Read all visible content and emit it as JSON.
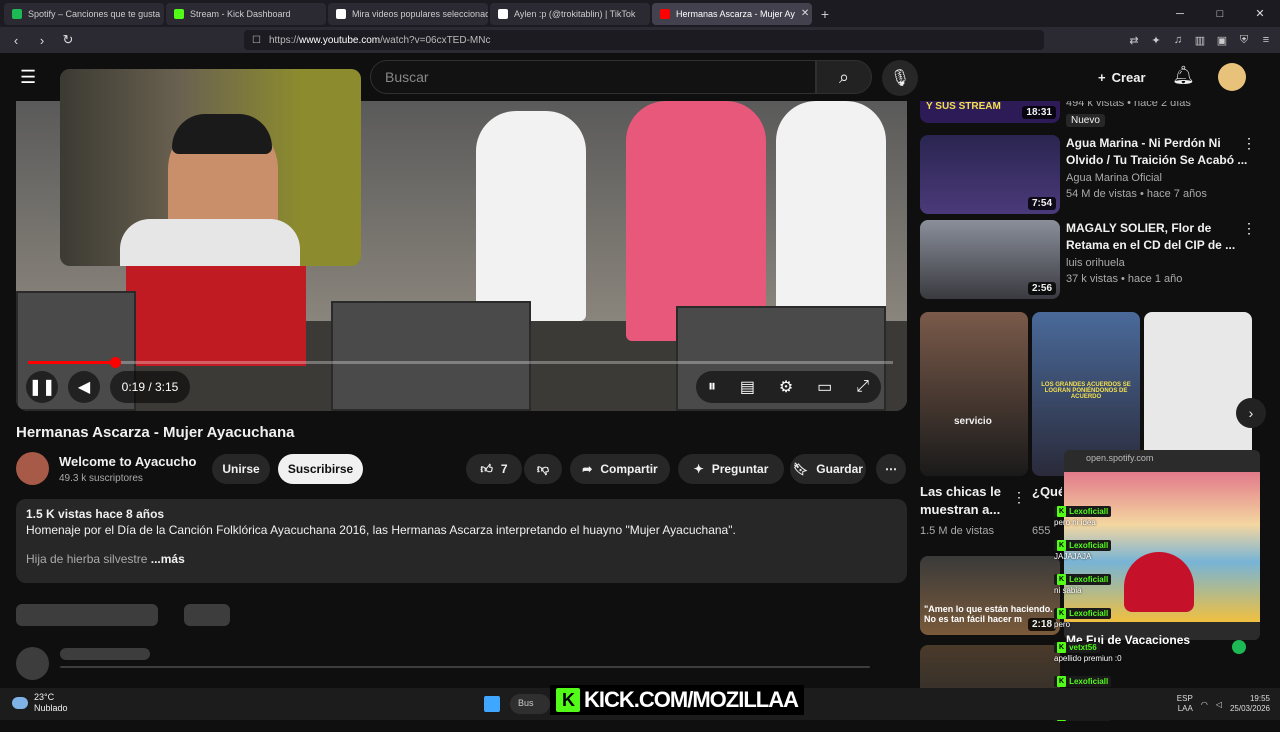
{
  "browser": {
    "tabs": [
      {
        "label": "Spotify – Canciones que te gusta",
        "color": "#1db954",
        "active": false
      },
      {
        "label": "Stream - Kick Dashboard",
        "color": "#53fc18",
        "active": false
      },
      {
        "label": "Mira videos populares seleccionado",
        "color": "#ffffff",
        "active": false
      },
      {
        "label": "Aylen :p (@trokitablin) | TikTok",
        "color": "#ffffff",
        "active": false
      },
      {
        "label": "Hermanas Ascarza - Mujer Ay",
        "color": "#ff0000",
        "active": true
      }
    ],
    "url_prefix": "https://",
    "url_domain": "www.youtube.com",
    "url_path": "/watch?v=06cxTED-MNc"
  },
  "header": {
    "search_placeholder": "Buscar",
    "create_label": "Crear"
  },
  "player": {
    "progress_fraction": 0.1,
    "time_label": "0:19 / 3:15"
  },
  "video": {
    "title": "Hermanas Ascarza - Mujer Ayacuchana",
    "channel": "Welcome to Ayacucho",
    "subscribers": "49.3 k suscriptores",
    "join_label": "Unirse",
    "subscribe_label": "Suscribirse",
    "likes": "7",
    "share_label": "Compartir",
    "ask_label": "Preguntar",
    "save_label": "Guardar",
    "desc_meta": "1.5 K vistas  hace 8 años",
    "desc_line1": "Homenaje por el Día de la Canción Folklórica Ayacuchana 2016, las Hermanas Ascarza interpretando el huayno \"Mujer Ayacuchana\".",
    "desc_line2": "Hija de hierba silvestre",
    "desc_more": "...más"
  },
  "sidebar": {
    "top_meta": "494 k vistas • hace 2 días",
    "top_badge": "Nuevo",
    "top_duration": "18:31",
    "top_thumb_text": "Y SUS STREAM",
    "videos": [
      {
        "title": "Agua Marina - Ni Perdón Ni Olvido / Tu Traición Se Acabó ...",
        "channel": "Agua Marina Oficial",
        "meta": "54 M de vistas • hace 7 años",
        "duration": "7:54"
      },
      {
        "title": "MAGALY SOLIER, Flor de Retama en el CD del CIP de ...",
        "channel": "luis orihuela",
        "meta": "37 k vistas • hace 1 año",
        "duration": "2:56"
      }
    ],
    "shorts": [
      {
        "caption": "servicio",
        "title": "Las chicas le muestran a...",
        "views": "1.5 M de vistas"
      },
      {
        "caption": "LOS GRANDES ACUERDOS SE LOGRAN PONIÉNDONOS DE ACUERDO",
        "title": "¿Qué César...",
        "views": "655"
      }
    ],
    "bottom_video": {
      "caption": "\"Amen lo que están haciendo. No es tan fácil hacer m",
      "duration": "2:18"
    }
  },
  "overlay": {
    "spotify_url": "open.spotify.com",
    "song_title": "Me Fui de Vacaciones",
    "chat": [
      {
        "user": "Lexoficiall",
        "text": "pero ni idea"
      },
      {
        "user": "Lexoficiall",
        "text": "JAJAJAJA"
      },
      {
        "user": "Lexoficiall",
        "text": "ni sabia"
      },
      {
        "user": "Lexoficiall",
        "text": "pero"
      },
      {
        "user": "vetxt56",
        "text": "apellido premiun :0"
      },
      {
        "user": "Lexoficiall",
        "text": "JAJAJAJAAJ"
      },
      {
        "user": "Lexoficiall",
        "text": ""
      }
    ],
    "kick_label": "KICK.COM/MOZILLAA"
  },
  "taskbar": {
    "temp": "23°C",
    "weather": "Nublado",
    "search_label": "Bus",
    "lang1": "ESP",
    "lang2": "LAA",
    "time": "19:55",
    "date": "25/03/2026"
  }
}
